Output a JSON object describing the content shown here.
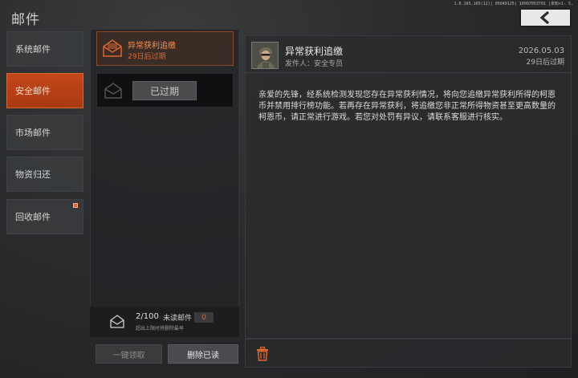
{
  "header": {
    "title": "邮件",
    "version": "1.0.165.165(12)| 05040125| 10997053701 |未知+1- 5."
  },
  "categories": [
    {
      "label": "系统邮件",
      "active": false,
      "badge": false
    },
    {
      "label": "安全邮件",
      "active": true,
      "badge": false
    },
    {
      "label": "市场邮件",
      "active": false,
      "badge": false
    },
    {
      "label": "物资归还",
      "active": false,
      "badge": false
    },
    {
      "label": "回收邮件",
      "active": false,
      "badge": true
    }
  ],
  "mail_list": [
    {
      "title": "异常获利追缴",
      "subtitle": "29日后过期",
      "selected": true
    },
    {
      "title": "",
      "subtitle": "",
      "selected": false,
      "status_label": "已过期"
    }
  ],
  "counter": {
    "count": "2/100",
    "unread_label": "未读邮件",
    "unread_count": "0",
    "note": "超出上限时将删除最早"
  },
  "buttons": {
    "claim_all": "一键领取",
    "delete_read": "删除已读"
  },
  "detail": {
    "title": "异常获利追缴",
    "sender": "发件人：安全专员",
    "date": "2026.05.03",
    "expires": "29日后过期",
    "body": "亲爱的先锋，经系统检测发现您存在异常获利情况，将向您追缴异常获利所得的柯恩币并禁用排行榜功能。若再存在异常获利，将追缴您非正常所得物资甚至更高数量的柯恩币，请正常进行游戏。若您对处罚有异议，请联系客服进行核实。"
  },
  "colors": {
    "accent": "#e0662f",
    "accent_dark": "#a93a12",
    "background": "#2a2b2d"
  }
}
